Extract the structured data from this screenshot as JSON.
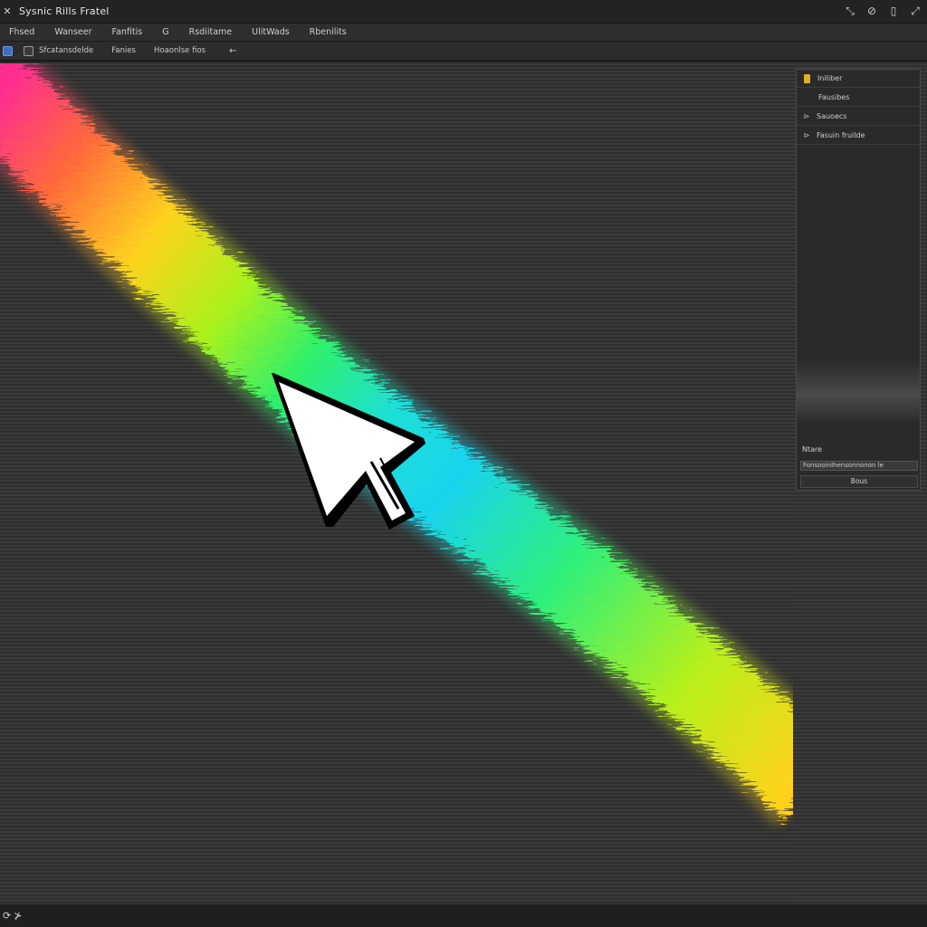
{
  "window": {
    "title": "Sysnic Rills Fratel",
    "controls": [
      "⤡",
      "⊘",
      "▯",
      "⤢"
    ]
  },
  "menu": {
    "items": [
      "Fhsed",
      "Wanseer",
      "Fanfitis",
      "G",
      "Rsdiitame",
      "UlitWads",
      "Rbenilits"
    ]
  },
  "toolbar": {
    "label_1": "Sfcatansdelde",
    "label_2": "Fanies",
    "label_3": "Hoaonlse fios",
    "arrow": "←"
  },
  "panel": {
    "rows": [
      {
        "icon": "",
        "label": "Iniliber"
      },
      {
        "icon": "",
        "label": "Fausibes"
      },
      {
        "icon": "⊳",
        "label": "Sauoecs"
      },
      {
        "icon": "⊳",
        "label": "Fasuin fruilde"
      }
    ],
    "footer_label": "Ntare",
    "field_value": "Fonsooinlhensonnonon le",
    "button_label": "Bous"
  },
  "statusbar": {
    "icon_1": "⟳",
    "icon_2": "⊁"
  },
  "canvas": {
    "cursor": "arrow-pointer",
    "brush_stroke_colors": [
      "#ff2f8e",
      "#ff6a3a",
      "#ffd21f",
      "#a9f21e",
      "#2ef06a",
      "#1ee0d6",
      "#19d4ee",
      "#2ff07a",
      "#b8f01a",
      "#ffd21f",
      "#ffb41e"
    ]
  }
}
